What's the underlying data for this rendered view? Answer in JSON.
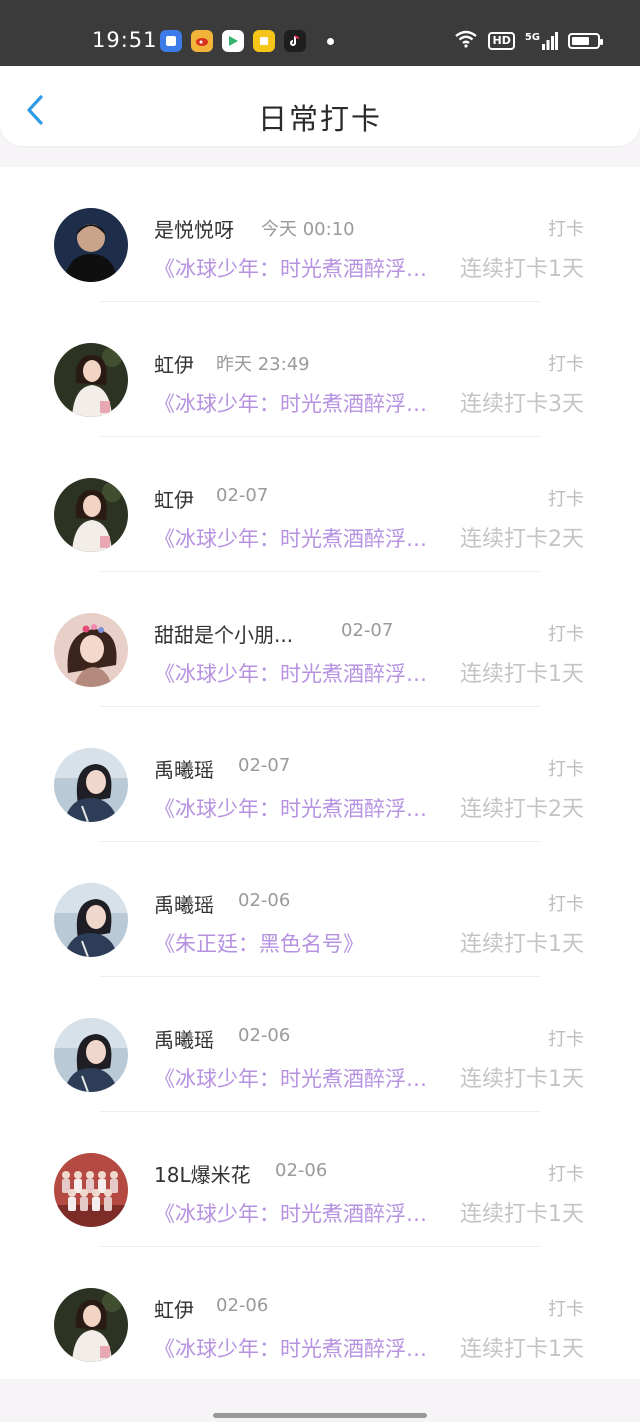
{
  "status_bar": {
    "time": "19:51",
    "app_icons": [
      {
        "name": "messages-app-icon",
        "color": "#3d7be8"
      },
      {
        "name": "weibo-app-icon",
        "color": "#f2b33a"
      },
      {
        "name": "video-app-icon",
        "color": "#35b36a"
      },
      {
        "name": "notes-app-icon",
        "color": "#f5c518"
      },
      {
        "name": "tiktok-app-icon",
        "color": "#1e1e1e"
      }
    ],
    "hd_label": "HD",
    "network_label": "5G",
    "battery_level": 0.75
  },
  "header": {
    "title": "日常打卡",
    "back_icon": "chevron-left-icon",
    "accent_color": "#2f9be8"
  },
  "list": {
    "tag_label": "打卡",
    "items": [
      {
        "name": "是悦悦呀",
        "time": "今天 00:10",
        "topic": "《冰球少年：时光煮酒醉浮生》",
        "streak": "连续打卡1天",
        "avatar": "dark-boy"
      },
      {
        "name": "虹伊",
        "time": "昨天 23:49",
        "topic": "《冰球少年：时光煮酒醉浮生》",
        "streak": "连续打卡3天",
        "avatar": "girl-white"
      },
      {
        "name": "虹伊",
        "time": "02-07",
        "topic": "《冰球少年：时光煮酒醉浮生》",
        "streak": "连续打卡2天",
        "avatar": "girl-white"
      },
      {
        "name": "甜甜是个小朋...",
        "time": "02-07",
        "topic": "《冰球少年：时光煮酒醉浮生》",
        "streak": "连续打卡1天",
        "avatar": "girl-pink"
      },
      {
        "name": "禹曦瑶",
        "time": "02-07",
        "topic": "《冰球少年：时光煮酒醉浮生》",
        "streak": "连续打卡2天",
        "avatar": "girl-blue"
      },
      {
        "name": "禹曦瑶",
        "time": "02-06",
        "topic": "《朱正廷：黑色名号》",
        "streak": "连续打卡1天",
        "avatar": "girl-blue"
      },
      {
        "name": "禹曦瑶",
        "time": "02-06",
        "topic": "《冰球少年：时光煮酒醉浮生》",
        "streak": "连续打卡1天",
        "avatar": "girl-blue"
      },
      {
        "name": "18L爆米花",
        "time": "02-06",
        "topic": "《冰球少年：时光煮酒醉浮生》",
        "streak": "连续打卡1天",
        "avatar": "group"
      },
      {
        "name": "虹伊",
        "time": "02-06",
        "topic": "《冰球少年：时光煮酒醉浮生》",
        "streak": "连续打卡1天",
        "avatar": "girl-white"
      }
    ]
  }
}
